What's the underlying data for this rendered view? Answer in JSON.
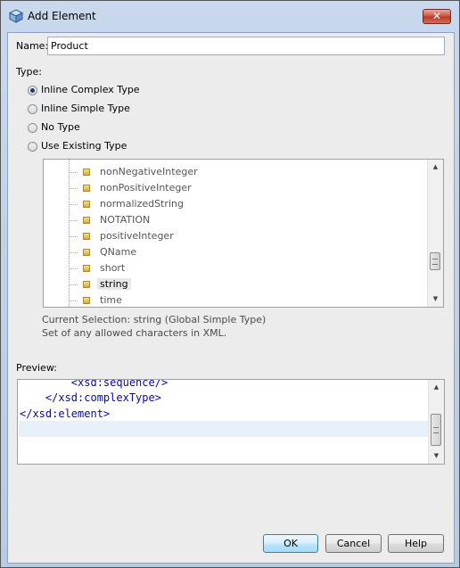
{
  "window": {
    "title": "Add Element",
    "close_glyph": "✕"
  },
  "name_field": {
    "label": "Name:",
    "value": "Product"
  },
  "type_section": {
    "label": "Type:",
    "options": [
      {
        "label": "Inline Complex Type",
        "selected": true
      },
      {
        "label": "Inline Simple Type",
        "selected": false
      },
      {
        "label": "No Type",
        "selected": false
      },
      {
        "label": "Use Existing Type",
        "selected": false
      }
    ]
  },
  "type_tree": {
    "items": [
      "nonNegativeInteger",
      "nonPositiveInteger",
      "normalizedString",
      "NOTATION",
      "positiveInteger",
      "QName",
      "short",
      "string",
      "time"
    ],
    "selected": "string",
    "item_icon": "simple-type-icon"
  },
  "selection_info": {
    "current": "Current Selection: string (Global Simple Type)",
    "description": "Set of any allowed characters in XML."
  },
  "preview": {
    "label": "Preview:",
    "lines": [
      "        <xsd:sequence/>",
      "    </xsd:complexType>",
      "</xsd:element>"
    ]
  },
  "buttons": {
    "ok": "OK",
    "cancel": "Cancel",
    "help": "Help"
  },
  "colors": {
    "title_bar": "#b9cce5",
    "close_button": "#c9503d",
    "xml_text": "#0a0a9a"
  }
}
